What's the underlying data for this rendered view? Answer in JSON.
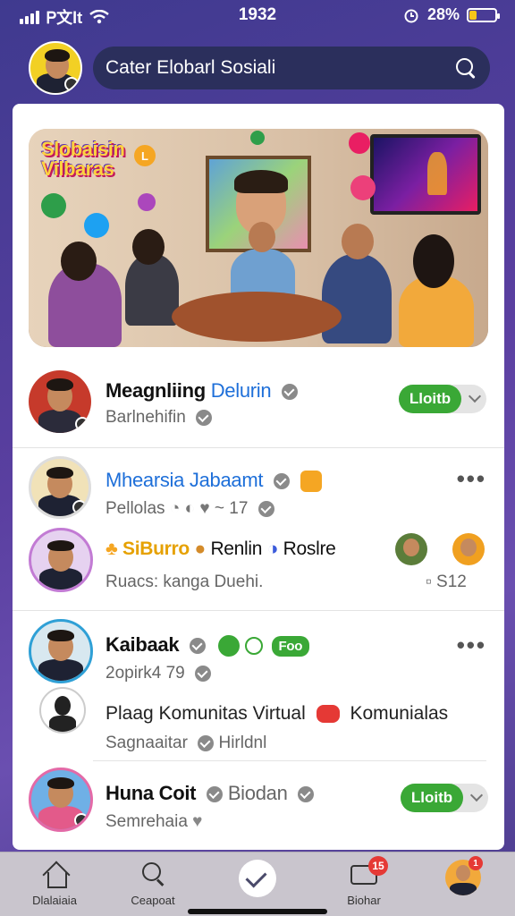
{
  "status_bar": {
    "carrier": "Ꮲ文lt",
    "time": "1932",
    "battery": "28%",
    "battery_level": 0.28
  },
  "header": {
    "search_text": "Cater Elobarl Sosiali",
    "icons": [
      "profile-avatar",
      "search-icon"
    ]
  },
  "banner": {
    "logo_text_line1": "Slobaisin",
    "logo_text_line2": "Vilbaras"
  },
  "feed": [
    {
      "name": "Meagnliing",
      "name_highlight": "Delurin",
      "sub": "Barlnehifin",
      "toggle_label": "Lloitb"
    },
    {
      "name_highlight": "Mhearsia Jabaamt",
      "sub": "Pellolas",
      "sub_count": "~ 17",
      "more": "•••",
      "tags": [
        "SiBurro",
        "Renlin",
        "Roslre"
      ],
      "caption": "Ruacs: kanga Duehi.",
      "caption_right": "S12"
    },
    {
      "name": "Kaibaak",
      "pill": "Foo",
      "sub": "2opirk4 79",
      "more": "•••",
      "community_text": "Plaag Komunitas Virtual",
      "community_text2": "Komunialas",
      "footer": "Sagnaaitar",
      "footer2": "Hirldnl"
    },
    {
      "name": "Huna Coit",
      "name_highlight": "Biodan",
      "sub": "Semrehaia",
      "toggle_label": "Lloitb"
    }
  ],
  "tabbar": {
    "tabs": [
      {
        "label": "Dlalaiaia",
        "icon": "home-icon"
      },
      {
        "label": "Ceapoat",
        "icon": "search-icon"
      },
      {
        "label": "",
        "icon": "check-icon"
      },
      {
        "label": "Biohar",
        "icon": "message-icon",
        "badge": "15"
      },
      {
        "label": "",
        "icon": "profile-avatar",
        "badge": "1"
      }
    ]
  },
  "colors": {
    "accent_green": "#3aa836",
    "highlight_blue": "#1e6fd9",
    "header_bg": "#4a3c8c"
  }
}
